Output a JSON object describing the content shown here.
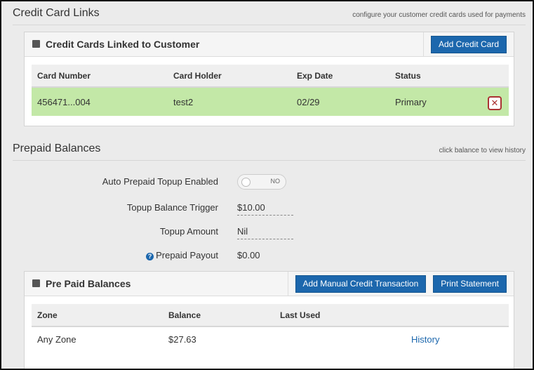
{
  "credit_card_links": {
    "title": "Credit Card Links",
    "hint": "configure your customer credit cards used for payments",
    "panel": {
      "title": "Credit Cards Linked to Customer",
      "add_button": "Add Credit Card",
      "columns": [
        "Card Number",
        "Card Holder",
        "Exp Date",
        "Status"
      ],
      "rows": [
        {
          "card_number": "456471...004",
          "card_holder": "test2",
          "exp_date": "02/29",
          "status": "Primary",
          "row_color": "#c3e8a7"
        }
      ]
    }
  },
  "prepaid_balances": {
    "title": "Prepaid Balances",
    "hint": "click balance to view history",
    "auto_topup": {
      "label": "Auto Prepaid Topup Enabled",
      "toggle_text": "NO"
    },
    "topup_trigger": {
      "label": "Topup Balance Trigger",
      "value": "$10.00"
    },
    "topup_amount": {
      "label": "Topup Amount",
      "value": "Nil"
    },
    "payout": {
      "label": "Prepaid Payout",
      "value": "$0.00",
      "icon": "help-icon"
    },
    "panel": {
      "title": "Pre Paid Balances",
      "manual_button": "Add Manual Credit Transaction",
      "print_button": "Print Statement",
      "columns": [
        "Zone",
        "Balance",
        "Last Used"
      ],
      "rows": [
        {
          "zone": "Any Zone",
          "balance": "$27.63",
          "last_used": "",
          "action": "History"
        }
      ]
    }
  },
  "colors": {
    "accent": "#1c67ad",
    "primary_row": "#c3e8a7",
    "danger": "#aa3333"
  }
}
